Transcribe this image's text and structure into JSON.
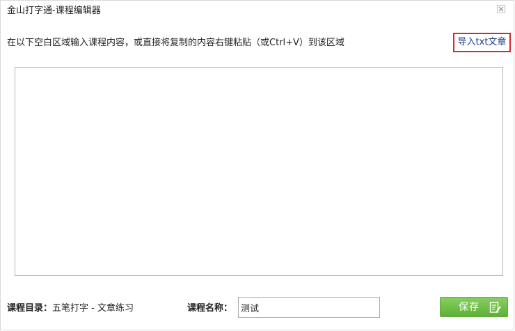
{
  "window": {
    "title": "金山打字通-课程编辑器"
  },
  "instruction": "在以下空白区域输入课程内容，或直接将复制的内容右键粘贴（或Ctrl+V）到该区域",
  "import_link": "导入txt文章",
  "editor": {
    "value": ""
  },
  "footer": {
    "catalog_label": "课程目录：",
    "catalog_value": "五笔打字 - 文章练习",
    "name_label": "课程名称：",
    "name_value": "测试",
    "save_label": "保存"
  },
  "icons": {
    "close": "close-icon",
    "save": "edit-document-icon"
  },
  "colors": {
    "save_button": "#6cbf45",
    "highlight_border": "#e0242b",
    "link": "#1a3a8a"
  }
}
